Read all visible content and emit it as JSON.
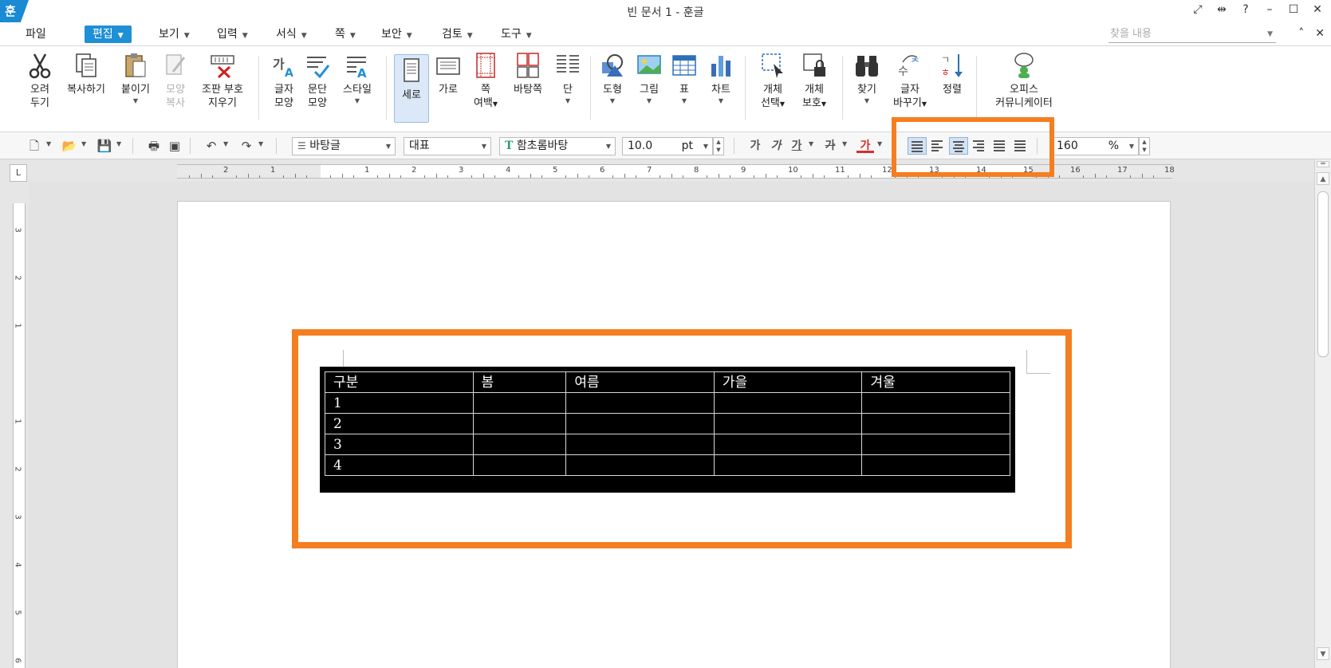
{
  "title_bar": {
    "logo": "훈",
    "title": "빈 문서 1 - 훈글",
    "icons": [
      "fullscreen-icon",
      "fit-width-icon",
      "help-icon",
      "minimize-icon",
      "maximize-icon",
      "close-icon"
    ],
    "glyphs": {
      "fullscreen": "⤢",
      "fitwidth": "⇹",
      "help": "?",
      "minimize": "–",
      "maximize": "☐",
      "close": "✕"
    }
  },
  "menu": {
    "items": [
      "파일",
      "편집",
      "보기",
      "입력",
      "서식",
      "쪽",
      "보안",
      "검토",
      "도구"
    ],
    "active": "편집",
    "search_placeholder": "찾을 내용",
    "right_glyphs": {
      "collapse": "˄",
      "close": "✕"
    }
  },
  "ribbon": {
    "buttons": [
      {
        "label1": "오려",
        "label2": "두기",
        "icon": "scissors-icon"
      },
      {
        "label1": "복사하기",
        "label2": "",
        "icon": "copy-icon"
      },
      {
        "label1": "붙이기",
        "label2": "",
        "icon": "paste-icon",
        "dropdown": true
      },
      {
        "label1": "모양",
        "label2": "복사",
        "icon": "format-painter-icon",
        "disabled": true
      },
      {
        "label1": "조판 부호",
        "label2": "지우기",
        "icon": "clear-markup-icon"
      },
      {
        "label1": "글자",
        "label2": "모양",
        "icon": "char-shape-icon"
      },
      {
        "label1": "문단",
        "label2": "모양",
        "icon": "para-shape-icon"
      },
      {
        "label1": "스타일",
        "label2": "",
        "icon": "style-icon",
        "dropdown": true
      },
      {
        "label1": "세로",
        "label2": "",
        "icon": "portrait-icon",
        "selected": true
      },
      {
        "label1": "가로",
        "label2": "",
        "icon": "landscape-icon"
      },
      {
        "label1": "쪽",
        "label2": "여백",
        "icon": "margin-icon",
        "dropdown": true
      },
      {
        "label1": "바탕쪽",
        "label2": "",
        "icon": "master-page-icon"
      },
      {
        "label1": "단",
        "label2": "",
        "icon": "columns-icon",
        "dropdown": true
      },
      {
        "label1": "도형",
        "label2": "",
        "icon": "shape-icon",
        "dropdown": true
      },
      {
        "label1": "그림",
        "label2": "",
        "icon": "picture-icon",
        "dropdown": true
      },
      {
        "label1": "표",
        "label2": "",
        "icon": "table-icon",
        "dropdown": true
      },
      {
        "label1": "차트",
        "label2": "",
        "icon": "chart-icon",
        "dropdown": true
      },
      {
        "label1": "개체",
        "label2": "선택",
        "icon": "object-select-icon",
        "dropdown": true
      },
      {
        "label1": "개체",
        "label2": "보호",
        "icon": "object-protect-icon",
        "dropdown": true
      },
      {
        "label1": "찾기",
        "label2": "",
        "icon": "binoculars-icon",
        "dropdown": true
      },
      {
        "label1": "글자",
        "label2": "바꾸기",
        "icon": "replace-icon",
        "dropdown": true
      },
      {
        "label1": "정렬",
        "label2": "",
        "icon": "sort-icon"
      },
      {
        "label1": "오피스",
        "label2": "커뮤니케이터",
        "icon": "communicator-icon"
      }
    ]
  },
  "format_bar": {
    "style": "바탕글",
    "lang": "대표",
    "font": "함초롬바탕",
    "font_icon": "T",
    "size": "10.0",
    "size_unit": "pt",
    "bold": "가",
    "italic": "가",
    "underline": "가",
    "strike": "가",
    "color": "가",
    "zoom": "160",
    "zoom_unit": "%",
    "alignment_selected": "center",
    "glyphs": {
      "new": "🗋",
      "open": "📂",
      "save": "💾",
      "print": "🖶",
      "preview": "▣",
      "undo": "↶",
      "redo": "↷",
      "spin_up": "▲",
      "spin_down": "▼"
    }
  },
  "ruler": {
    "corner": "L",
    "h_numbers": [
      "2",
      "1",
      "1",
      "2",
      "3",
      "4",
      "5",
      "6",
      "7",
      "8",
      "9",
      "10",
      "11",
      "12",
      "13",
      "14",
      "15",
      "16",
      "17",
      "18"
    ],
    "v_numbers": [
      "3",
      "2",
      "1",
      "1",
      "2",
      "3",
      "4",
      "5",
      "6"
    ]
  },
  "document": {
    "table": {
      "headers": [
        "구분",
        "봄",
        "여름",
        "가을",
        "겨울"
      ],
      "rows": [
        [
          "1",
          "",
          "",
          "",
          ""
        ],
        [
          "2",
          "",
          "",
          "",
          ""
        ],
        [
          "3",
          "",
          "",
          "",
          ""
        ],
        [
          "4",
          "",
          "",
          "",
          ""
        ]
      ]
    }
  },
  "colors": {
    "accent": "#1f8fd6",
    "highlight": "#f57e20",
    "table_bg": "#000000"
  }
}
